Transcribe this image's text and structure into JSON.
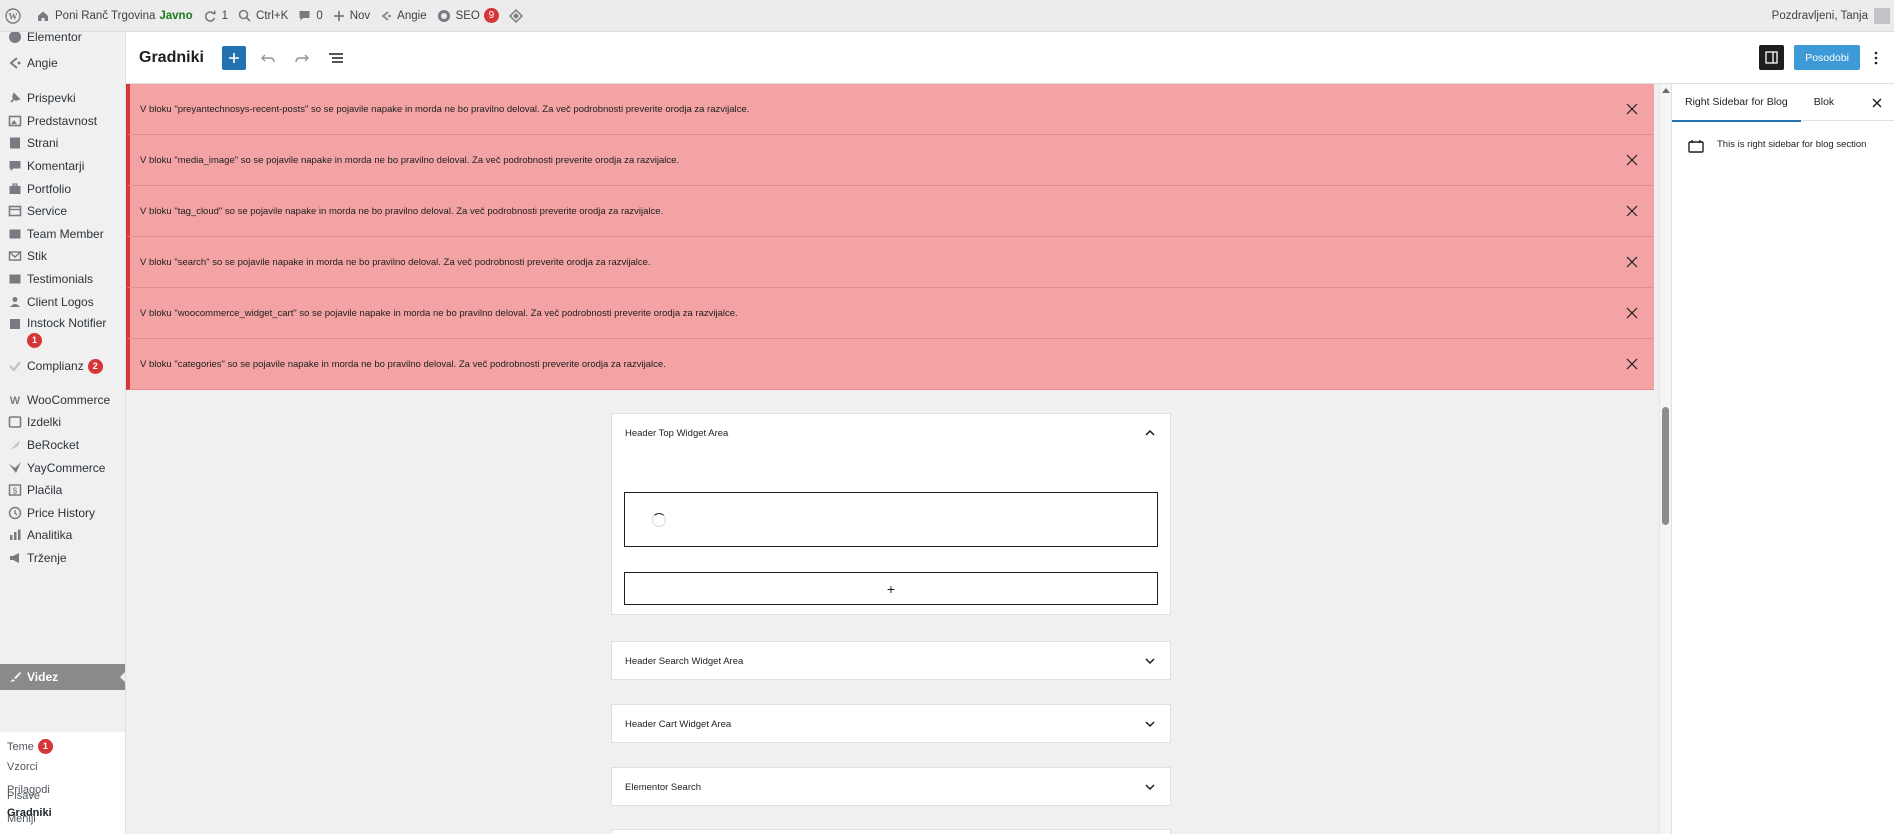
{
  "admin_bar": {
    "site_name": "Poni Ranč Trgovina",
    "site_status": "Javno",
    "updates_count": "1",
    "search_shortcut": "Ctrl+K",
    "comments_count": "0",
    "new_label": "Nov",
    "user_link": "Angie",
    "seo_label": "SEO",
    "seo_count": "9",
    "greeting": "Pozdravljeni, Tanja"
  },
  "admin_menu": {
    "items": [
      {
        "label": "Elementor",
        "icon": "elementor-icon"
      },
      {
        "label": "Angie",
        "icon": "angie-icon"
      },
      {
        "label": "Prispevki",
        "icon": "pin-icon"
      },
      {
        "label": "Predstavnost",
        "icon": "media-icon"
      },
      {
        "label": "Strani",
        "icon": "page-icon"
      },
      {
        "label": "Komentarji",
        "icon": "comment-icon"
      },
      {
        "label": "Portfolio",
        "icon": "portfolio-icon"
      },
      {
        "label": "Service",
        "icon": "service-icon"
      },
      {
        "label": "Team Member",
        "icon": "team-icon"
      },
      {
        "label": "Stik",
        "icon": "mail-icon"
      },
      {
        "label": "Testimonials",
        "icon": "testimonial-icon"
      },
      {
        "label": "Client Logos",
        "icon": "client-icon"
      },
      {
        "label": "Instock Notifier",
        "icon": "notifier-icon",
        "badge": "1"
      },
      {
        "label": "Complianz",
        "icon": "check-icon",
        "badge": "2"
      },
      {
        "label": "WooCommerce",
        "icon": "woo-icon"
      },
      {
        "label": "Izdelki",
        "icon": "archive-icon"
      },
      {
        "label": "BeRocket",
        "icon": "berocket-icon"
      },
      {
        "label": "YayCommerce",
        "icon": "yay-icon"
      },
      {
        "label": "Plačila",
        "icon": "payment-icon"
      },
      {
        "label": "Price History",
        "icon": "history-icon"
      },
      {
        "label": "Analitika",
        "icon": "chart-icon"
      },
      {
        "label": "Trženje",
        "icon": "megaphone-icon"
      }
    ],
    "current": {
      "label": "Videz",
      "icon": "brush-icon"
    },
    "submenu": [
      {
        "label": "Teme",
        "badge": "1"
      },
      {
        "label": "Vzorci"
      },
      {
        "label": "Prilagodi"
      },
      {
        "label": "Gradniki"
      },
      {
        "label": "Pisave"
      },
      {
        "label": "Meniji"
      }
    ]
  },
  "editor_header": {
    "title": "Gradniki",
    "update_label": "Posodobi"
  },
  "notices": [
    "V bloku \"preyantechnosys-recent-posts\" so se pojavile napake in morda ne bo pravilno deloval. Za več podrobnosti preverite orodja za razvijalce.",
    "V bloku \"media_image\" so se pojavile napake in morda ne bo pravilno deloval. Za več podrobnosti preverite orodja za razvijalce.",
    "V bloku \"tag_cloud\" so se pojavile napake in morda ne bo pravilno deloval. Za več podrobnosti preverite orodja za razvijalce.",
    "V bloku \"search\" so se pojavile napake in morda ne bo pravilno deloval. Za več podrobnosti preverite orodja za razvijalce.",
    "V bloku \"woocommerce_widget_cart\" so se pojavile napake in morda ne bo pravilno deloval. Za več podrobnosti preverite orodja za razvijalce.",
    "V bloku \"categories\" so se pojavile napake in morda ne bo pravilno deloval. Za več podrobnosti preverite orodja za razvijalce."
  ],
  "widget_areas": [
    {
      "title": "Header Top Widget Area",
      "expanded": true
    },
    {
      "title": "Header Search Widget Area",
      "expanded": false
    },
    {
      "title": "Header Cart Widget Area",
      "expanded": false
    },
    {
      "title": "Elementor Search",
      "expanded": false
    }
  ],
  "appender_symbol": "+",
  "sidebar": {
    "tabs": [
      "Right Sidebar for Blog",
      "Blok"
    ],
    "active_tab": "Right Sidebar for Blog",
    "description": "This is right sidebar for blog section"
  },
  "colors": {
    "notice_bg": "#f3a3a3",
    "notice_border": "#d63638",
    "accent": "#2271b1",
    "update_button": "#3e9ad6",
    "badge": "#d63638"
  }
}
